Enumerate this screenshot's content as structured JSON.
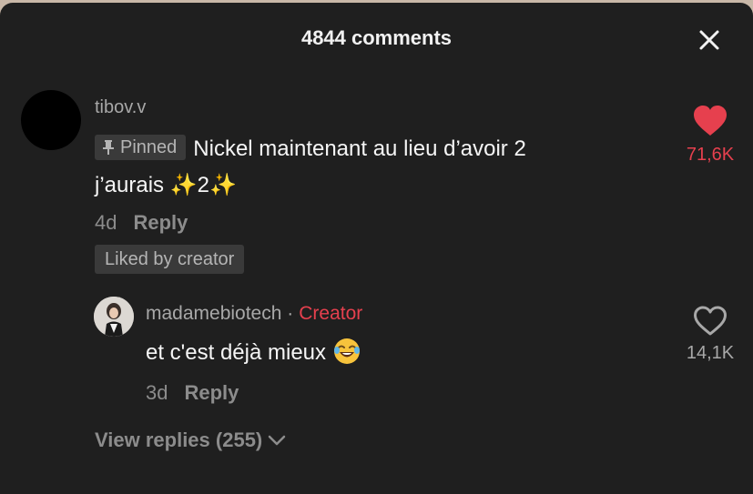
{
  "header": {
    "title": "4844 comments"
  },
  "comment": {
    "username": "tibov.v",
    "pinned_label": "Pinned",
    "text_line1": "Nickel maintenant au lieu d’avoir 2",
    "text_line2_a": "j’aurais ",
    "sparkle": "✨",
    "text_line2_num": "2",
    "age": "4d",
    "reply_label": "Reply",
    "liked_by_creator": "Liked by creator",
    "like_count": "71,6K",
    "liked": true
  },
  "reply": {
    "username": "madamebiotech",
    "separator": "·",
    "creator_label": "Creator",
    "text": "et c'est déjà mieux",
    "emoji": "face-with-tears-of-joy",
    "age": "3d",
    "reply_label": "Reply",
    "like_count": "14,1K",
    "liked": false
  },
  "view_replies": {
    "label": "View replies (255)"
  },
  "colors": {
    "background": "#1f1f1f",
    "like_active": "#e6404e",
    "creator": "#e6404e",
    "muted_text": "#8c8c8c"
  }
}
